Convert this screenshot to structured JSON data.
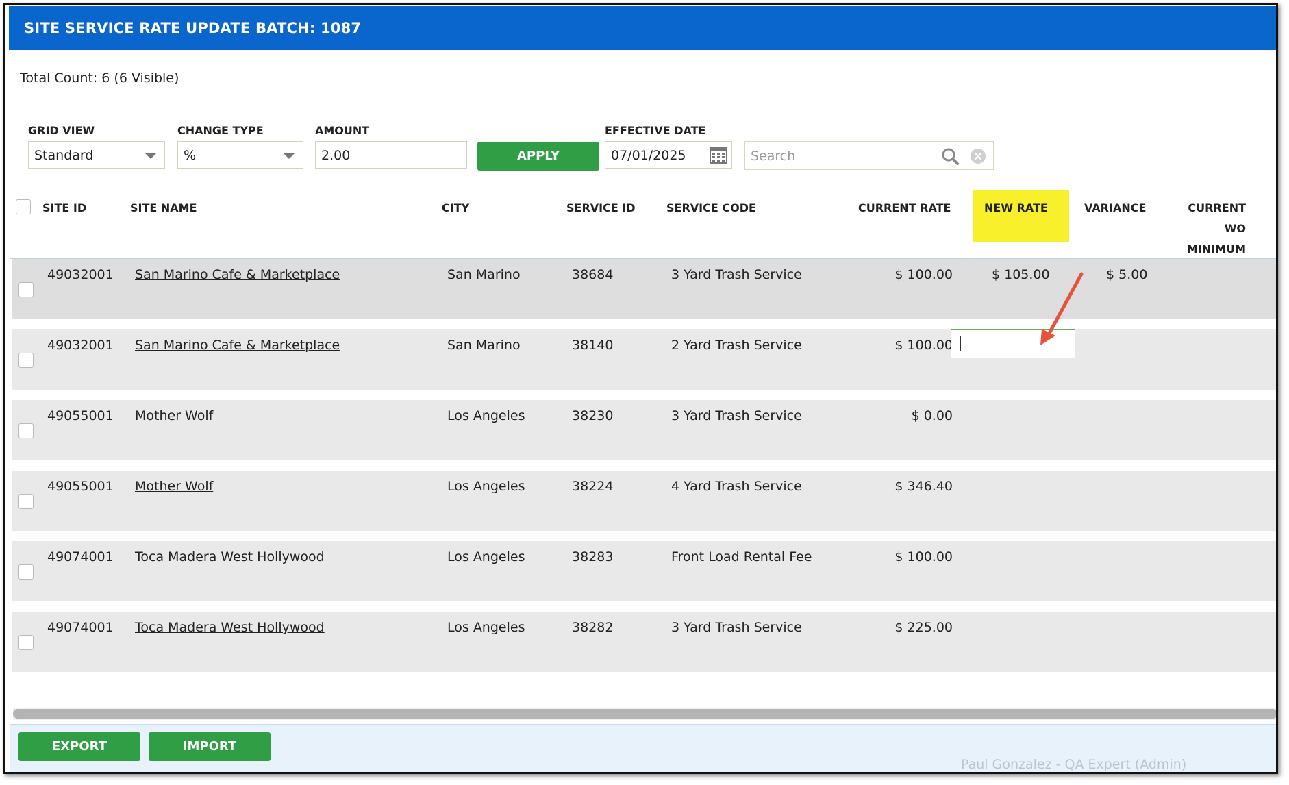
{
  "window": {
    "title": "SITE SERVICE RATE UPDATE BATCH: 1087"
  },
  "summary": {
    "total_count": "Total Count: 6 (6 Visible)"
  },
  "controls": {
    "grid_view_label": "GRID VIEW",
    "grid_view_value": "Standard",
    "change_type_label": "CHANGE TYPE",
    "change_type_value": "%",
    "amount_label": "AMOUNT",
    "amount_value": "2.00",
    "apply_label": "APPLY",
    "effective_date_label": "EFFECTIVE DATE",
    "effective_date_value": "07/01/2025",
    "search_placeholder": "Search",
    "icons": {
      "calendar": "calendar-icon",
      "search": "search-icon",
      "clear": "clear-icon"
    }
  },
  "table": {
    "columns": {
      "site_id": "SITE ID",
      "site_name": "SITE NAME",
      "city": "CITY",
      "service_id": "SERVICE ID",
      "service_code": "SERVICE CODE",
      "current_rate": "CURRENT RATE",
      "new_rate": "NEW RATE",
      "variance": "VARIANCE",
      "current_wo_1": "CURRENT WO",
      "current_wo_2": "MINIMUM"
    },
    "rows": [
      {
        "site_id": "49032001",
        "site_name": "San Marino Cafe & Marketplace",
        "city": "San Marino",
        "service_id": "38684",
        "service_code": "3 Yard Trash Service",
        "current_rate": "$ 100.00",
        "new_rate": "$ 105.00",
        "variance": "$ 5.00"
      },
      {
        "site_id": "49032001",
        "site_name": "San Marino Cafe & Marketplace",
        "city": "San Marino",
        "service_id": "38140",
        "service_code": "2 Yard Trash Service",
        "current_rate": "$ 100.00",
        "new_rate": "",
        "variance": ""
      },
      {
        "site_id": "49055001",
        "site_name": "Mother Wolf",
        "city": "Los Angeles",
        "service_id": "38230",
        "service_code": "3 Yard Trash Service",
        "current_rate": "$ 0.00",
        "new_rate": "",
        "variance": ""
      },
      {
        "site_id": "49055001",
        "site_name": "Mother Wolf",
        "city": "Los Angeles",
        "service_id": "38224",
        "service_code": "4 Yard Trash Service",
        "current_rate": "$ 346.40",
        "new_rate": "",
        "variance": ""
      },
      {
        "site_id": "49074001",
        "site_name": "Toca Madera West Hollywood",
        "city": "Los Angeles",
        "service_id": "38283",
        "service_code": "Front Load Rental Fee",
        "current_rate": "$ 100.00",
        "new_rate": "",
        "variance": ""
      },
      {
        "site_id": "49074001",
        "site_name": "Toca Madera West Hollywood",
        "city": "Los Angeles",
        "service_id": "38282",
        "service_code": "3 Yard Trash Service",
        "current_rate": "$ 225.00",
        "new_rate": "",
        "variance": ""
      }
    ]
  },
  "footer": {
    "export_label": "EXPORT",
    "import_label": "IMPORT",
    "background_text": "Paul Gonzalez - QA Expert (Admin)"
  },
  "colors": {
    "title_bar": "#0a66cc",
    "button": "#2f9e44",
    "highlight": "#f7f02a",
    "arrow": "#e5533d"
  }
}
